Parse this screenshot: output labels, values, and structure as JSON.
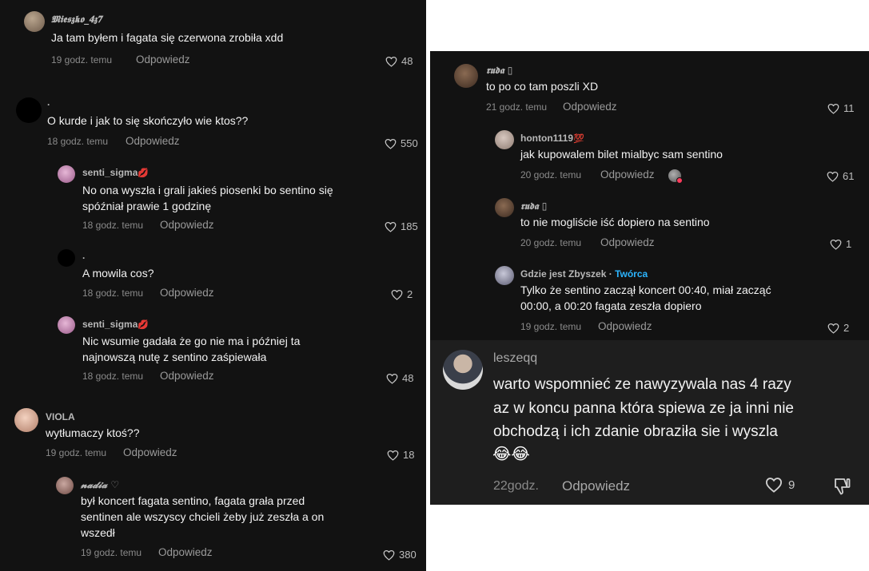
{
  "left_top": {
    "c1": {
      "user": "𝕸𝖎𝖊𝖘𝖟𝖐𝖔_𝟒𝖟𝟕",
      "text": "Ja tam byłem i fagata się czerwona zrobiła xdd",
      "time": "19 godz. temu",
      "reply": "Odpowiedz",
      "likes": "48"
    },
    "c2": {
      "user": ".",
      "text": "O kurde i jak to się skończyło wie ktos??",
      "time": "18 godz. temu",
      "reply": "Odpowiedz",
      "likes": "550"
    },
    "c3": {
      "user": "senti_sigma",
      "badge": "💋",
      "text1": "No ona wyszła i grali jakieś piosenki bo sentino się",
      "text2": "spóźniał prawie 1 godzinę",
      "time": "18 godz. temu",
      "reply": "Odpowiedz",
      "likes": "185"
    },
    "c4": {
      "user": ".",
      "text": "A mowila cos?",
      "time": "18 godz. temu",
      "reply": "Odpowiedz",
      "likes": "2"
    },
    "c5": {
      "user": "senti_sigma",
      "badge": "💋",
      "text1": "Nic wsumie gadała że go nie ma i później ta",
      "text2": "najnowszą nutę z sentino zaśpiewała",
      "time": "18 godz. temu",
      "reply": "Odpowiedz",
      "likes": "48"
    }
  },
  "left_bottom": {
    "c1": {
      "user": "VIOLA",
      "text": "wytłumaczy ktoś??",
      "time": "19 godz. temu",
      "reply": "Odpowiedz",
      "likes": "18"
    },
    "c2": {
      "user": "𝓷𝓪𝓭𝓲𝓪",
      "badge": "♡",
      "text1": "był koncert fagata sentino, fagata grała przed",
      "text2": "sentinen ale wszyscy chcieli żeby już zeszła a on",
      "text3": "wszedł",
      "time": "19 godz. temu",
      "reply": "Odpowiedz",
      "likes": "380"
    }
  },
  "right": {
    "c1": {
      "user": "𝖗𝖚𝖉𝖆 ▯",
      "text": "to po co tam poszli XD",
      "time": "21 godz. temu",
      "reply": "Odpowiedz",
      "likes": "11"
    },
    "c2": {
      "user": "honton1119",
      "badge": "💯",
      "text": "jak kupowalem bilet mialbyc sam sentino",
      "time": "20 godz. temu",
      "reply": "Odpowiedz",
      "likes": "61"
    },
    "c3": {
      "user": "𝖗𝖚𝖉𝖆 ▯",
      "text": "to nie mogliście iść dopiero na sentino",
      "time": "20 godz. temu",
      "reply": "Odpowiedz",
      "likes": "1"
    },
    "c4": {
      "user": "Gdzie jest Zbyszek",
      "dot": "·",
      "creator": "Twórca",
      "text1": "Tylko że sentino zaczął koncert 00:40, miał zacząć",
      "text2": "00:00, a 00:20 fagata zeszła dopiero",
      "time": "19 godz. temu",
      "reply": "Odpowiedz",
      "likes": "2"
    }
  },
  "big": {
    "user": "leszeqq",
    "text1": "warto wspomnieć ze nawyzywala nas 4 razy",
    "text2": "az w koncu panna która spiewa ze ja inni nie",
    "text3": "obchodzą i ich zdanie obraziła sie i wyszla",
    "emojis": "😂😂",
    "time": "22godz.",
    "reply": "Odpowiedz",
    "likes": "9"
  },
  "icons": {
    "like": "heart-icon",
    "dislike": "thumbs-down-icon"
  },
  "colors": {
    "background": "#121212",
    "highlight_panel": "#1e1e1e",
    "creator": "#2cb5ff",
    "meta": "#8a8a8a"
  }
}
